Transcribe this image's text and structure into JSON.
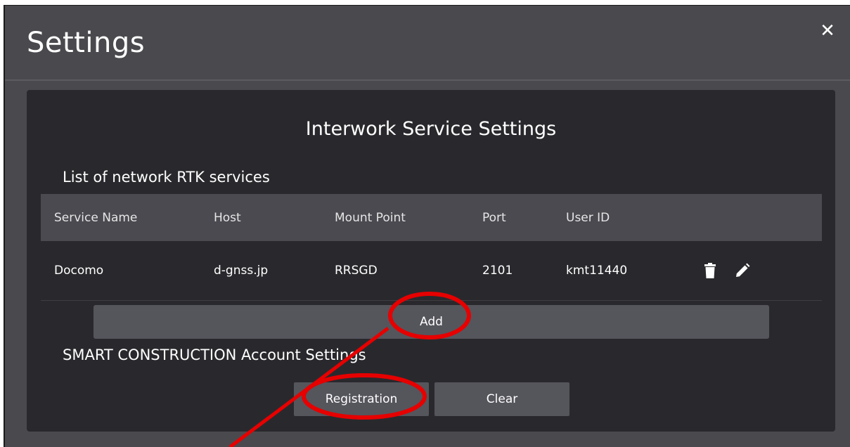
{
  "window": {
    "title": "Settings",
    "close_icon": "close-icon"
  },
  "panel": {
    "title": "Interwork Service Settings",
    "rtk_section_label": "List of network RTK services",
    "account_section_label": "SMART CONSTRUCTION Account Settings"
  },
  "table": {
    "headers": [
      "Service Name",
      "Host",
      "Mount Point",
      "Port",
      "User ID"
    ],
    "rows": [
      {
        "service_name": "Docomo",
        "host": "d-gnss.jp",
        "mount_point": "RRSGD",
        "port": "2101",
        "user_id": "kmt11440",
        "actions": [
          "trash-icon",
          "pencil-icon"
        ]
      }
    ]
  },
  "buttons": {
    "add": "Add",
    "registration": "Registration",
    "clear": "Clear"
  },
  "annotations": {
    "color": "#e60000",
    "shapes": [
      "ellipse-around-add",
      "ellipse-around-registration",
      "arrow-line"
    ]
  },
  "colors": {
    "window_bg": "#4a4a4e",
    "panel_bg": "#29292d",
    "header_bg": "#4a4a50",
    "button_bg": "#55555c"
  }
}
